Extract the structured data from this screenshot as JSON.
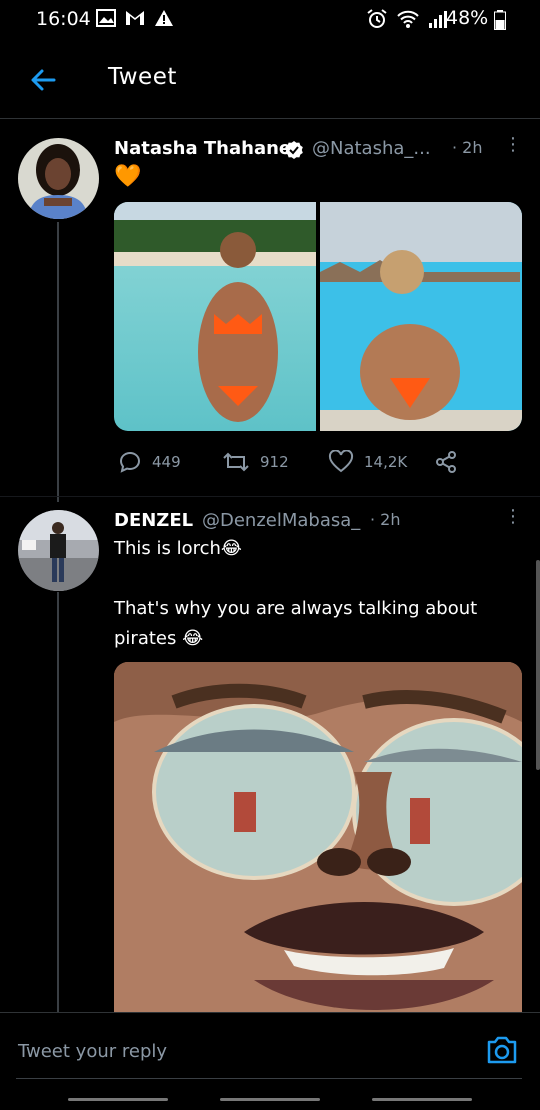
{
  "status": {
    "time": "16:04",
    "battery": "48%"
  },
  "header": {
    "title": "Tweet"
  },
  "tweet1": {
    "name": "Natasha Thahane",
    "handle": "@Natasha_...",
    "time": "· 2h",
    "text": "🧡",
    "replies": "449",
    "retweets": "912",
    "likes": "14,2K"
  },
  "tweet2": {
    "name": "DENZEL",
    "handle": "@DenzelMabasa_",
    "time": "· 2h",
    "line1": "This is lorch😂",
    "line2": "That's  why you are always talking about",
    "line3": "pirates 😂"
  },
  "reply": {
    "placeholder": "Tweet your reply"
  },
  "colors": {
    "accent": "#1d9bf0",
    "verified": "#ffffff",
    "muted": "#8b98a5",
    "background": "#000000"
  }
}
